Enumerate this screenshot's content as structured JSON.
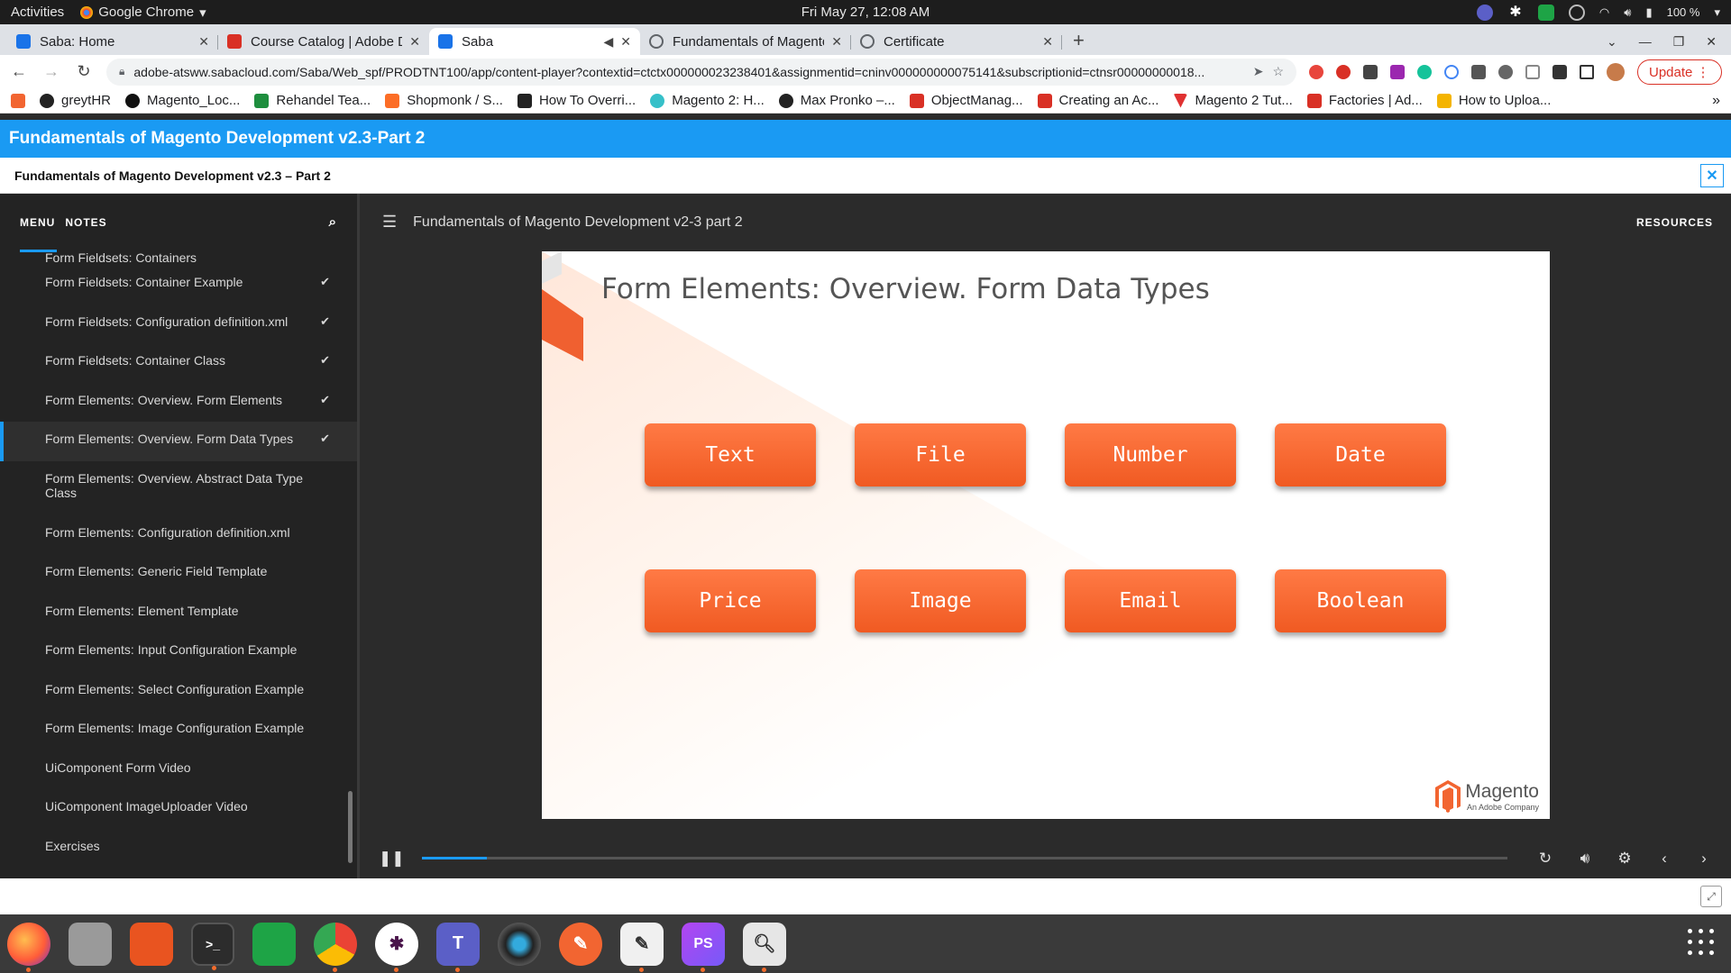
{
  "system_bar": {
    "activities": "Activities",
    "app_name": "Google Chrome",
    "clock": "Fri May 27, 12:08 AM",
    "battery": "100 %"
  },
  "tabs": [
    {
      "title": "Saba: Home",
      "color": "#1a73e8"
    },
    {
      "title": "Course Catalog | Adobe D",
      "color": "#d93025"
    },
    {
      "title": "Saba",
      "color": "#1a73e8"
    },
    {
      "title": "Fundamentals of Magento",
      "color": "#5f6368"
    },
    {
      "title": "Certificate",
      "color": "#5f6368"
    }
  ],
  "omnibox": {
    "url": "adobe-atsww.sabacloud.com/Saba/Web_spf/PRODTNT100/app/content-player?contextid=ctctx000000023238401&assignmentid=cninv000000000075141&subscriptionid=ctnsr00000000018...",
    "update_label": "Update"
  },
  "bookmarks": [
    "greytHR",
    "Magento_Loc...",
    "Rehandel Tea...",
    "Shopmonk / S...",
    "How To Overri...",
    "Magento 2: H...",
    "Max Pronko –...",
    "ObjectManag...",
    "Creating an Ac...",
    "Magento 2 Tut...",
    "Factories | Ad...",
    "How to Uploa..."
  ],
  "course": {
    "header_title": "Fundamentals of Magento Development v2.3-Part 2",
    "sub_title": "Fundamentals of Magento Development v2.3 – Part 2"
  },
  "sidebar": {
    "menu_label": "MENU",
    "notes_label": "NOTES",
    "items": [
      {
        "label": "Form Fieldsets: Containers",
        "done": true
      },
      {
        "label": "Form Fieldsets: Container Example",
        "done": true
      },
      {
        "label": "Form Fieldsets: Configuration definition.xml",
        "done": true
      },
      {
        "label": "Form Fieldsets: Container Class",
        "done": true
      },
      {
        "label": "Form Elements: Overview. Form Elements",
        "done": true
      },
      {
        "label": "Form Elements: Overview. Form Data Types",
        "done": true
      },
      {
        "label": "Form Elements: Overview. Abstract Data Type Class",
        "done": false
      },
      {
        "label": "Form Elements: Configuration definition.xml",
        "done": false
      },
      {
        "label": "Form Elements: Generic Field Template",
        "done": false
      },
      {
        "label": "Form Elements: Element Template",
        "done": false
      },
      {
        "label": "Form Elements: Input Configuration Example",
        "done": false
      },
      {
        "label": "Form Elements: Select Configuration Example",
        "done": false
      },
      {
        "label": "Form Elements: Image Configuration Example",
        "done": false
      },
      {
        "label": "UiComponent Form Video",
        "done": false
      },
      {
        "label": "UiComponent ImageUploader Video",
        "done": false
      },
      {
        "label": "Exercises",
        "done": false
      }
    ]
  },
  "player": {
    "title": "Fundamentals of Magento Development v2-3 part 2",
    "resources_label": "RESOURCES",
    "progress": 0.06
  },
  "slide": {
    "title": "Form Elements: Overview. Form Data Types",
    "data_types": [
      "Text",
      "File",
      "Number",
      "Date",
      "Price",
      "Image",
      "Email",
      "Boolean"
    ],
    "logo_wordmark": "Magento",
    "logo_sub": "An Adobe Company"
  },
  "colors": {
    "accent": "#1a9af3",
    "button_orange": "#f26531"
  }
}
